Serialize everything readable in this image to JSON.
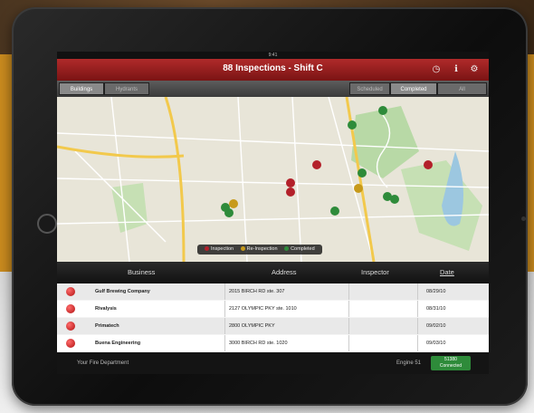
{
  "statusbar": {
    "time": "9:41"
  },
  "header": {
    "title": "88 Inspections - Shift C",
    "icons": [
      "clock-icon",
      "info-icon",
      "gear-icon"
    ]
  },
  "tabs": {
    "left": [
      {
        "label": "Buildings",
        "active": true
      },
      {
        "label": "Hydrants",
        "active": false
      }
    ],
    "right": [
      {
        "label": "Scheduled",
        "active": false
      },
      {
        "label": "Completed",
        "active": true
      },
      {
        "label": "All",
        "active": false
      }
    ]
  },
  "map": {
    "legend": {
      "inspection": "Inspection",
      "re_inspection": "Re-Inspection",
      "completed": "Completed"
    },
    "colors": {
      "inspection": "#b3202a",
      "re_inspection": "#c79a1a",
      "completed": "#2e8b3a",
      "water": "#9cc7e0",
      "park": "#b8d9a6",
      "road": "#f2c94c"
    }
  },
  "table": {
    "columns": [
      "Business",
      "Address",
      "Inspector",
      "Date"
    ],
    "rows": [
      {
        "business": "Gulf Brewing Company",
        "address": "2015 BIRCH RD ste. 307",
        "inspector": "",
        "date": "08/29/10"
      },
      {
        "business": "Rivalysis",
        "address": "2127 OLYMPIC PKY ste. 1010",
        "inspector": "",
        "date": "08/31/10"
      },
      {
        "business": "Primatech",
        "address": "2800 OLYMPIC PKY",
        "inspector": "",
        "date": "09/02/10"
      },
      {
        "business": "Buena Engineering",
        "address": "3000 BIRCH RD ste. 1020",
        "inspector": "",
        "date": "09/03/10"
      }
    ]
  },
  "footer": {
    "department": "Your Fire Department",
    "engine": "Engine 51",
    "badge_line1": "51380",
    "badge_line2": "Connected"
  }
}
